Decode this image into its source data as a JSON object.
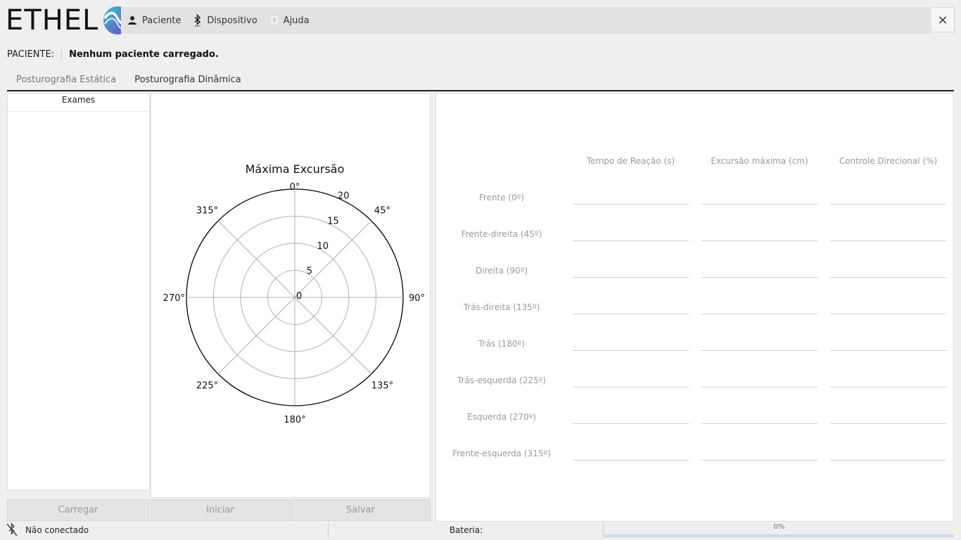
{
  "app": {
    "logo_text": "ETHEL",
    "brand_colors": {
      "teal": "#3ec7c2",
      "purple": "#6b3fd6",
      "accent": "#4a7fb8"
    }
  },
  "menubar": {
    "items": [
      {
        "label": "Paciente",
        "icon": "person-icon"
      },
      {
        "label": "Dispositivo",
        "icon": "bluetooth-icon"
      },
      {
        "label": "Ajuda",
        "icon": "help-icon"
      }
    ],
    "close_label": "×"
  },
  "patient": {
    "label": "PACIENTE:",
    "value": "Nenhum paciente carregado."
  },
  "tabs": [
    {
      "label": "Posturografia Estática",
      "active": false
    },
    {
      "label": "Posturografia Dinâmica",
      "active": true
    }
  ],
  "exams": {
    "header": "Exames",
    "items": []
  },
  "buttons": {
    "load": "Carregar",
    "start": "Iniciar",
    "save": "Salvar"
  },
  "chart_data": {
    "type": "polar",
    "title": "Máxima Excursão",
    "radial_ticks": [
      "0",
      "5",
      "10",
      "15",
      "20"
    ],
    "radial_values": [
      0,
      5,
      10,
      15,
      20
    ],
    "rmax": 20,
    "angle_labels": [
      "0°",
      "45°",
      "90°",
      "135°",
      "180°",
      "225°",
      "270°",
      "315°"
    ],
    "angles": [
      0,
      45,
      90,
      135,
      180,
      225,
      270,
      315
    ],
    "series": [],
    "grid": true
  },
  "results": {
    "columns": [
      "Tempo de Reação (s)",
      "Excursão máxima (cm)",
      "Controle Direcional (%)"
    ],
    "rows": [
      {
        "label": "Frente (0º)",
        "values": [
          "",
          "",
          ""
        ]
      },
      {
        "label": "Frente-direita (45º)",
        "values": [
          "",
          "",
          ""
        ]
      },
      {
        "label": "Direita (90º)",
        "values": [
          "",
          "",
          ""
        ]
      },
      {
        "label": "Trás-direita (135º)",
        "values": [
          "",
          "",
          ""
        ]
      },
      {
        "label": "Trás (180º)",
        "values": [
          "",
          "",
          ""
        ]
      },
      {
        "label": "Trás-esquerda (225º)",
        "values": [
          "",
          "",
          ""
        ]
      },
      {
        "label": "Esquerda (270º)",
        "values": [
          "",
          "",
          ""
        ]
      },
      {
        "label": "Frente-esquerda (315º)",
        "values": [
          "",
          "",
          ""
        ]
      }
    ]
  },
  "status": {
    "connection": "Não conectado",
    "battery_label": "Bateria:",
    "battery_text": "0%",
    "battery_percent": 0
  }
}
